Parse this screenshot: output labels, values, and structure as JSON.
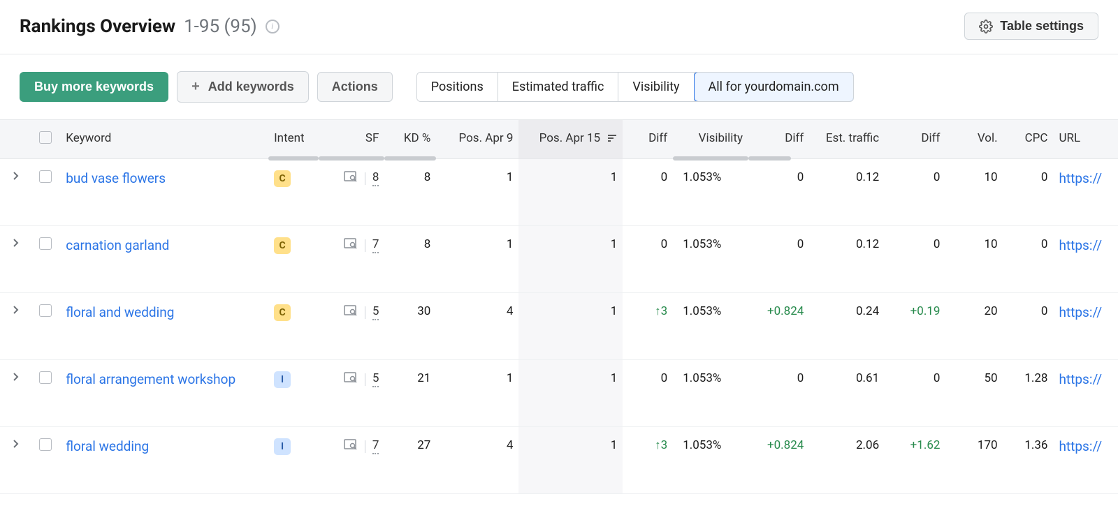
{
  "header": {
    "title": "Rankings Overview",
    "range": "1-95 (95)",
    "settings_label": "Table settings"
  },
  "toolbar": {
    "buy_label": "Buy more keywords",
    "add_label": "Add keywords",
    "actions_label": "Actions",
    "segments": {
      "positions": "Positions",
      "est_traffic": "Estimated traffic",
      "visibility": "Visibility",
      "all_for": "All for yourdomain.com"
    }
  },
  "columns": {
    "keyword": "Keyword",
    "intent": "Intent",
    "sf": "SF",
    "kd": "KD %",
    "pos1": "Pos. Apr 9",
    "pos2": "Pos. Apr 15",
    "d1": "Diff",
    "vis": "Visibility",
    "d2": "Diff",
    "est": "Est. traffic",
    "d3": "Diff",
    "vol": "Vol.",
    "cpc": "CPC",
    "url": "URL"
  },
  "rows": [
    {
      "keyword": "bud vase flowers",
      "intent": "C",
      "sf": "8",
      "kd": "8",
      "pos1": "1",
      "pos2": "1",
      "d1": "0",
      "vis": "1.053%",
      "d2": "0",
      "est": "0.12",
      "d3": "0",
      "vol": "10",
      "cpc": "0",
      "url": "https://"
    },
    {
      "keyword": "carnation garland",
      "intent": "C",
      "sf": "7",
      "kd": "8",
      "pos1": "1",
      "pos2": "1",
      "d1": "0",
      "vis": "1.053%",
      "d2": "0",
      "est": "0.12",
      "d3": "0",
      "vol": "10",
      "cpc": "0",
      "url": "https://"
    },
    {
      "keyword": "floral and wedding",
      "intent": "C",
      "sf": "5",
      "kd": "30",
      "pos1": "4",
      "pos2": "1",
      "d1": "↑3",
      "d1_positive": true,
      "vis": "1.053%",
      "d2": "+0.824",
      "d2_positive": true,
      "est": "0.24",
      "d3": "+0.19",
      "d3_positive": true,
      "vol": "20",
      "cpc": "0",
      "url": "https://"
    },
    {
      "keyword": "floral arrangement workshop",
      "intent": "I",
      "sf": "5",
      "kd": "21",
      "pos1": "1",
      "pos2": "1",
      "d1": "0",
      "vis": "1.053%",
      "d2": "0",
      "est": "0.61",
      "d3": "0",
      "vol": "50",
      "cpc": "1.28",
      "url": "https://"
    },
    {
      "keyword": "floral wedding",
      "intent": "I",
      "sf": "7",
      "kd": "27",
      "pos1": "4",
      "pos2": "1",
      "d1": "↑3",
      "d1_positive": true,
      "vis": "1.053%",
      "d2": "+0.824",
      "d2_positive": true,
      "est": "2.06",
      "d3": "+1.62",
      "d3_positive": true,
      "vol": "170",
      "cpc": "1.36",
      "url": "https://"
    }
  ]
}
